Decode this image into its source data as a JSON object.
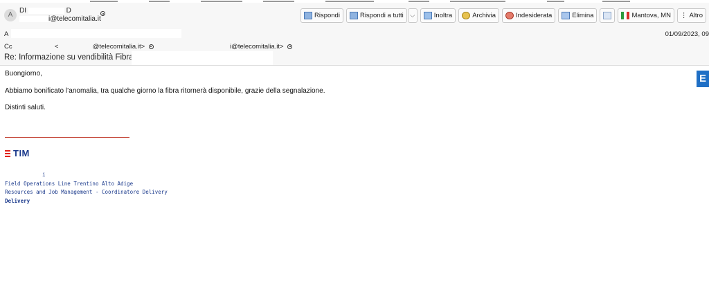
{
  "header": {
    "avatar_letter": "A",
    "sender_name": "DI",
    "sender_initial_tail": "D",
    "sender_email": "i@telecomitalia.it",
    "to_label": "A",
    "to_value": ".",
    "date": "01/09/2023, 09",
    "cc_label": "Cc",
    "cc_first_bracket": "<",
    "cc_first_domain": "@telecomitalia.it>",
    "cc_second_domain": "i@telecomitalia.it>",
    "subject": "Re: Informazione su vendibilità Fibra a"
  },
  "toolbar": {
    "reply": "Rispondi",
    "reply_all": "Rispondi a tutti",
    "reply_all_menu": "⌵",
    "forward": "Inoltra",
    "archive": "Archivia",
    "junk": "Indesiderata",
    "delete": "Elimina",
    "location": "Mantova, MN",
    "more": "Altro",
    "more_icon": "⋮",
    "flag_colors": [
      "#2e9a3d",
      "#ffffff",
      "#d9312a"
    ]
  },
  "body": {
    "greeting": "Buongiorno,",
    "message": "Abbiamo bonificato l’anomalia, tra qualche giorno la fibra ritornerà disponibile, grazie della segnalazione.",
    "closing": "Distinti saluti."
  },
  "signature": {
    "logo_text": "TIM",
    "logo_color": "#1b3a8c",
    "accent_color": "#e2231a",
    "name_tail": "i",
    "dept_line": "Field Operations Line Trentino Alto Adige",
    "role_line": "Resources and Job Management - Coordinatore Delivery",
    "extra_line": "Delivery"
  },
  "sidebar": {
    "ext_icon_letter": "E"
  }
}
